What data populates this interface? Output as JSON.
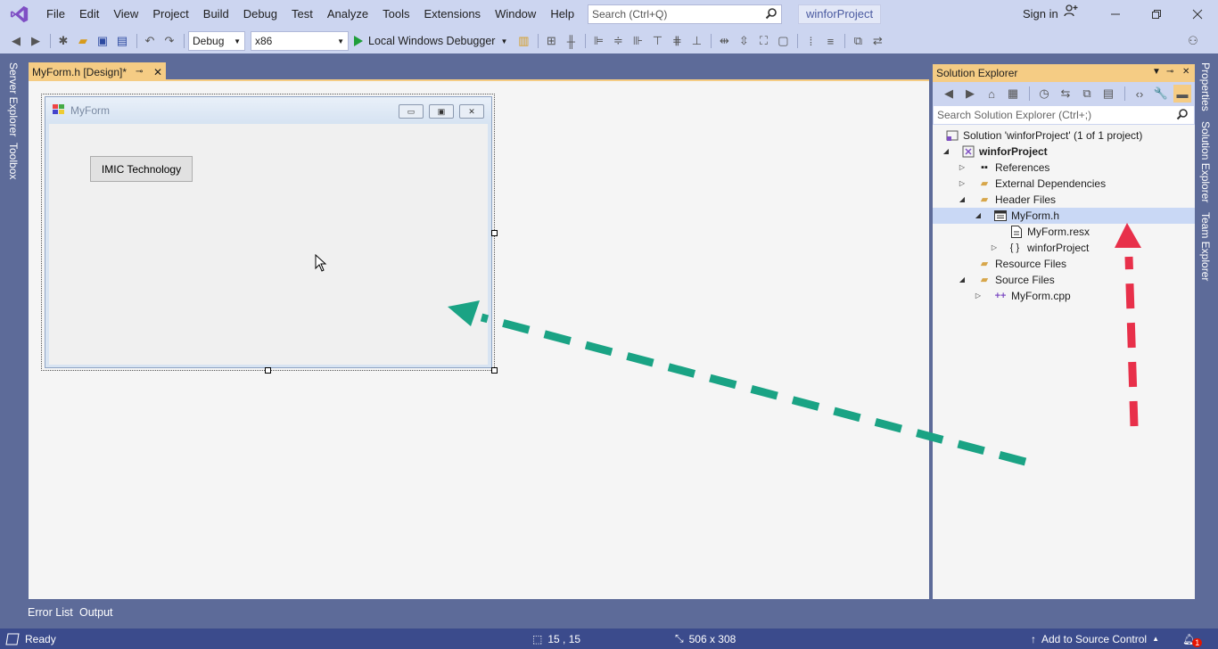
{
  "app": {
    "menu": [
      "File",
      "Edit",
      "View",
      "Project",
      "Build",
      "Debug",
      "Test",
      "Analyze",
      "Tools",
      "Extensions",
      "Window",
      "Help"
    ],
    "search_placeholder": "Search (Ctrl+Q)",
    "project_name": "winforProject",
    "sign_in": "Sign in"
  },
  "toolbar": {
    "config": "Debug",
    "platform": "x86",
    "debugger": "Local Windows Debugger"
  },
  "left_tabs": [
    "Server Explorer",
    "Toolbox"
  ],
  "document": {
    "tab_label": "MyForm.h [Design]*"
  },
  "form": {
    "title": "MyForm",
    "button_label": "IMIC Technology"
  },
  "solution_explorer": {
    "title": "Solution Explorer",
    "search_placeholder": "Search Solution Explorer (Ctrl+;)",
    "tree": [
      {
        "label": "Solution 'winforProject' (1 of 1 project)",
        "icon": "solution-icon"
      },
      {
        "label": "winforProject",
        "icon": "project-icon"
      },
      {
        "label": "References",
        "icon": "references-icon"
      },
      {
        "label": "External Dependencies",
        "icon": "folder-icon"
      },
      {
        "label": "Header Files",
        "icon": "folder-icon"
      },
      {
        "label": "MyForm.h",
        "icon": "form-icon"
      },
      {
        "label": "MyForm.resx",
        "icon": "resx-icon"
      },
      {
        "label": "winforProject",
        "icon": "namespace-icon"
      },
      {
        "label": "Resource Files",
        "icon": "folder-icon"
      },
      {
        "label": "Source Files",
        "icon": "folder-icon"
      },
      {
        "label": "MyForm.cpp",
        "icon": "cpp-icon"
      }
    ]
  },
  "right_tabs": [
    "Properties",
    "Solution Explorer",
    "Team Explorer"
  ],
  "bottom_tabs": [
    "Error List",
    "Output"
  ],
  "status": {
    "ready": "Ready",
    "position": "15 , 15",
    "size": "506 x 308",
    "source_control": "Add to Source Control",
    "notifications": "1"
  },
  "colors": {
    "accent_tab": "#f5cc84",
    "chrome": "#ccd5f0",
    "frame": "#5d6b99",
    "statusbar": "#3b4b8c",
    "green_arrow": "#1aa384",
    "red_arrow": "#e8304a"
  }
}
